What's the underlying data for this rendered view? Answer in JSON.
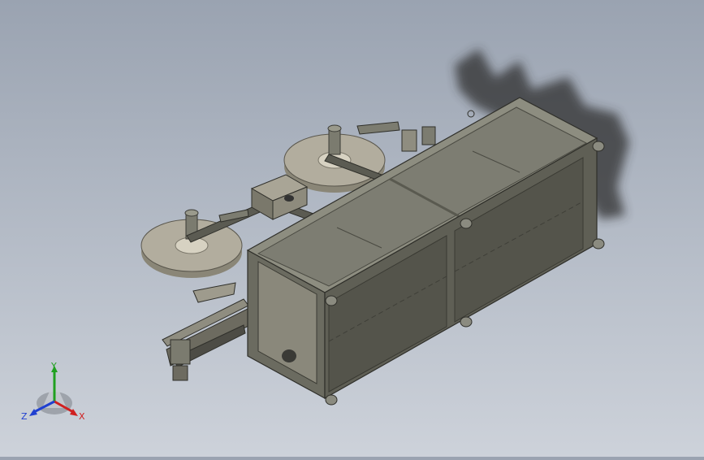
{
  "viewport": {
    "model": "sheet-metal-cabinet-assembly",
    "colors": {
      "background_top": "#9aa3b1",
      "background_bottom": "#cdd2da",
      "frame": "#6f6f63",
      "frame_light": "#9a9a8c",
      "panel_top": "#8d8d80",
      "panel_side": "#5f5f55",
      "wheel": "#b2ad9e",
      "shadow": "#3a3a3a"
    }
  },
  "triad": {
    "x_label": "X",
    "y_label": "Y",
    "z_label": "Z",
    "x_color": "#d02020",
    "y_color": "#20a020",
    "z_color": "#2040d0"
  }
}
